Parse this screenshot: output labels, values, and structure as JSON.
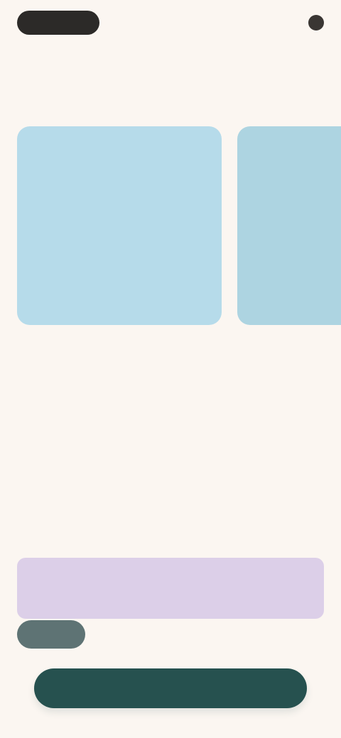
{
  "header": {
    "brand": "",
    "actions": ""
  },
  "section": {
    "heading": ""
  },
  "cards": [
    {
      "title": "",
      "text": ""
    },
    {
      "title": "",
      "text": ""
    }
  ],
  "hero": {
    "title": ""
  },
  "notice": {
    "text": "",
    "tag": ""
  },
  "cta": {
    "label": ""
  }
}
